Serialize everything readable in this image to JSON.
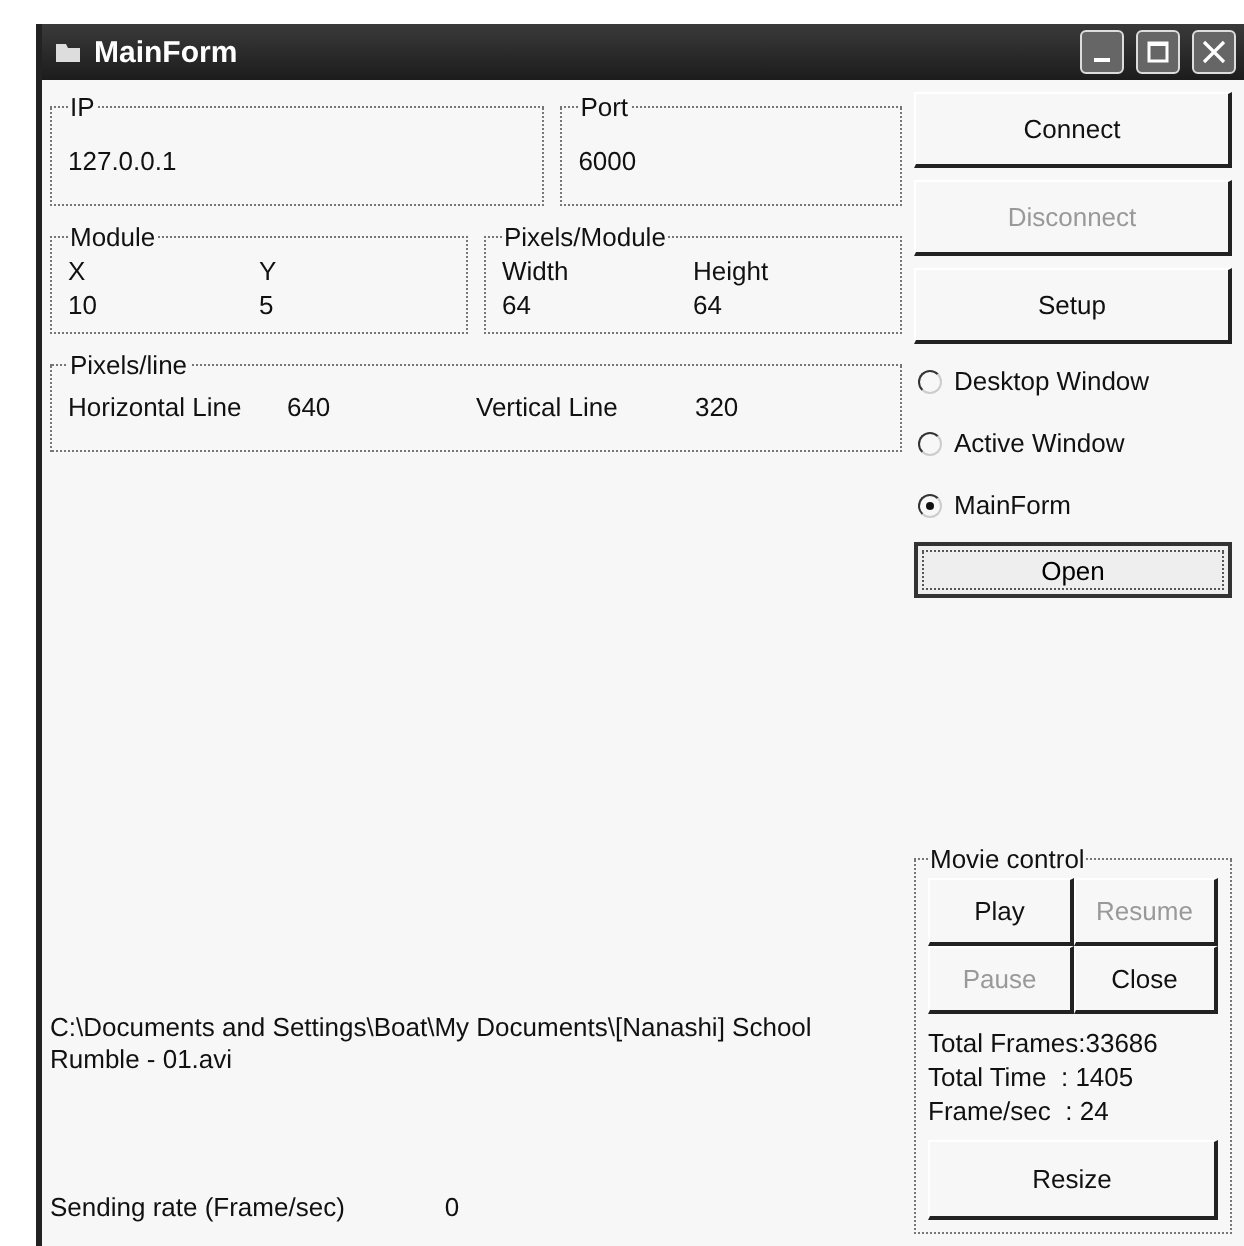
{
  "window": {
    "title": "MainForm"
  },
  "ip": {
    "label": "IP",
    "value": "127.0.0.1"
  },
  "port": {
    "label": "Port",
    "value": "6000"
  },
  "module": {
    "label": "Module",
    "columns": [
      {
        "header": "X",
        "value": "10"
      },
      {
        "header": "Y",
        "value": "5"
      }
    ]
  },
  "pixels_module": {
    "label": "Pixels/Module",
    "columns": [
      {
        "header": "Width",
        "value": "64"
      },
      {
        "header": "Height",
        "value": "64"
      }
    ]
  },
  "pixels_line": {
    "label": "Pixels/line",
    "items": [
      {
        "label": "Horizontal Line",
        "value": "640"
      },
      {
        "label": "Vertical Line",
        "value": "320"
      }
    ]
  },
  "buttons": [
    {
      "label": "Connect",
      "disabled": false
    },
    {
      "label": "Disconnect",
      "disabled": true
    },
    {
      "label": "Setup",
      "disabled": false
    }
  ],
  "capture": [
    {
      "label": "Desktop Window",
      "selected": false
    },
    {
      "label": "Active Window",
      "selected": false
    },
    {
      "label": "MainForm",
      "selected": true
    }
  ],
  "open_button": {
    "label": "Open"
  },
  "file_path": "C:\\Documents and Settings\\Boat\\My Documents\\[Nanashi] School Rumble - 01.avi",
  "sending_rate": {
    "label": "Sending rate (Frame/sec)",
    "value": "0"
  },
  "movie_control": {
    "label": "Movie control",
    "buttons": [
      {
        "label": "Play",
        "disabled": false
      },
      {
        "label": "Resume",
        "disabled": true
      },
      {
        "label": "Pause",
        "disabled": true
      },
      {
        "label": "Close",
        "disabled": false
      }
    ],
    "stats": [
      "Total Frames:33686",
      "Total Time  : 1405",
      "Frame/sec  : 24"
    ],
    "resize": {
      "label": "Resize"
    }
  }
}
